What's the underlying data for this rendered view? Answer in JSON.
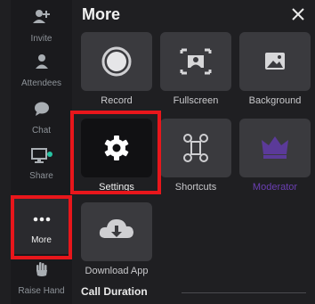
{
  "sidebar": {
    "items": [
      {
        "label": "Invite",
        "icon": "add-user-icon"
      },
      {
        "label": "Attendees",
        "icon": "person-icon"
      },
      {
        "label": "Chat",
        "icon": "chat-bubble-icon"
      },
      {
        "label": "Share",
        "icon": "screen-share-icon"
      },
      {
        "label": "More",
        "icon": "ellipsis-icon"
      },
      {
        "label": "Raise Hand",
        "icon": "raise-hand-icon"
      }
    ]
  },
  "panel": {
    "title": "More",
    "close_icon": "close-icon",
    "tiles": [
      {
        "label": "Record",
        "icon": "record-icon"
      },
      {
        "label": "Fullscreen",
        "icon": "fullscreen-icon"
      },
      {
        "label": "Background",
        "icon": "image-icon"
      },
      {
        "label": "Settings",
        "icon": "gear-icon"
      },
      {
        "label": "Shortcuts",
        "icon": "command-key-icon"
      },
      {
        "label": "Moderator",
        "icon": "crown-icon"
      },
      {
        "label": "Download App",
        "icon": "cloud-download-icon"
      }
    ],
    "section_title": "Call Duration"
  },
  "colors": {
    "highlight": "#e8161b",
    "moderator": "#6b3fb3",
    "share_status_dot": "#27c4a3"
  }
}
